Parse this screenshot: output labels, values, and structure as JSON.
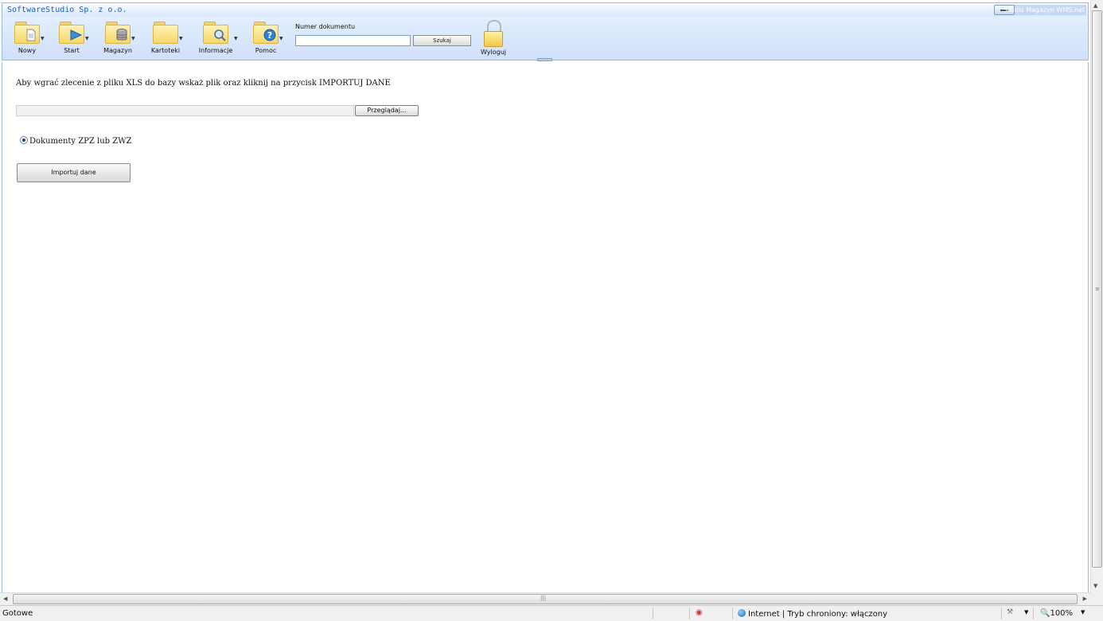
{
  "window": {
    "company_title": "SoftwareStudio Sp. z o.o.",
    "app_title": "Studio Magazyn WMS.net"
  },
  "toolbar": {
    "buttons": [
      {
        "label": "Nowy",
        "icon": "new-document-folder-icon"
      },
      {
        "label": "Start",
        "icon": "start-play-folder-icon"
      },
      {
        "label": "Magazyn",
        "icon": "warehouse-database-folder-icon"
      },
      {
        "label": "Kartoteki",
        "icon": "records-folder-icon"
      },
      {
        "label": "Informacje",
        "icon": "info-search-folder-icon"
      },
      {
        "label": "Pomoc",
        "icon": "help-folder-icon"
      }
    ],
    "search_label": "Numer dokumentu",
    "search_value": "",
    "search_button": "Szukaj",
    "logout_label": "Wyloguj"
  },
  "content": {
    "instruction": "Aby wgrać zlecenie z pliku XLS do bazy wskaż plik oraz kliknij na przycisk IMPORTUJ DANE",
    "file_value": "",
    "browse_label": "Przeglądaj...",
    "radio_label": "Dokumenty ZPZ lub ZWZ",
    "import_label": "Importuj dane"
  },
  "statusbar": {
    "status": "Gotowe",
    "zone": "Internet | Tryb chroniony: włączony",
    "zoom": "100%"
  },
  "colors": {
    "toolbar_bg": "#d6e6fb",
    "border": "#9cbbe3",
    "title_text": "#1f5fb3"
  }
}
